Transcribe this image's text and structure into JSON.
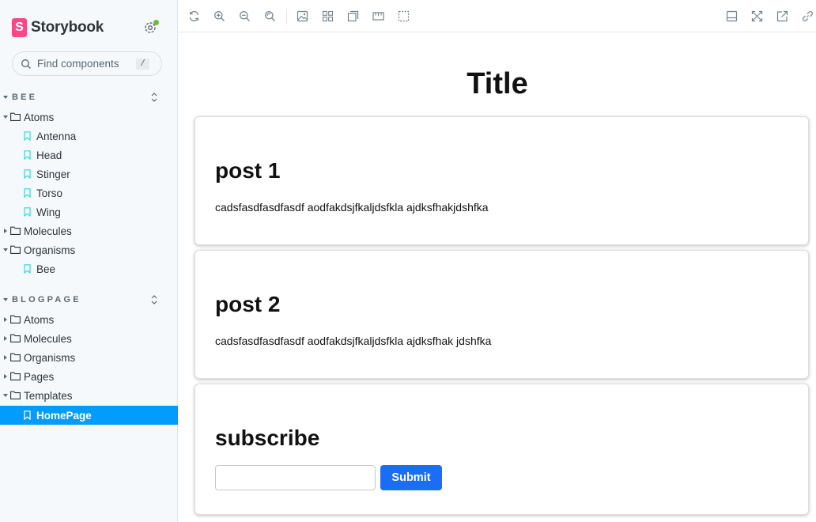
{
  "brand": {
    "name": "Storybook",
    "logo_letter": "S"
  },
  "search": {
    "placeholder": "Find components",
    "shortcut": "/"
  },
  "sidebar": {
    "sections": [
      {
        "label": "BEE"
      },
      {
        "label": "BLOGPAGE"
      }
    ],
    "items": [
      {
        "label": "Atoms"
      },
      {
        "label": "Antenna"
      },
      {
        "label": "Head"
      },
      {
        "label": "Stinger"
      },
      {
        "label": "Torso"
      },
      {
        "label": "Wing"
      },
      {
        "label": "Molecules"
      },
      {
        "label": "Organisms"
      },
      {
        "label": "Bee"
      },
      {
        "label": "Atoms"
      },
      {
        "label": "Molecules"
      },
      {
        "label": "Organisms"
      },
      {
        "label": "Pages"
      },
      {
        "label": "Templates"
      },
      {
        "label": "HomePage"
      }
    ],
    "active_item": "HomePage"
  },
  "toolbar": {
    "icons": [
      "reload-icon",
      "zoom-in-icon",
      "zoom-out-icon",
      "zoom-reset-icon",
      "background-icon",
      "grid-icon",
      "outline-icon",
      "measure-icon",
      "viewport-icon",
      "addons-panel-icon",
      "fullscreen-icon",
      "open-new-tab-icon",
      "copy-link-icon"
    ]
  },
  "canvas": {
    "title": "Title",
    "posts": [
      {
        "heading": "post 1",
        "body": "cadsfasdfasdfasdf aodfakdsjfkaljdsfkla ajdksfhakjdshfka"
      },
      {
        "heading": "post 2",
        "body": "cadsfasdfasdfasdf aodfakdsjfkaljdsfkla ajdksfhak jdshfka"
      }
    ],
    "subscribe": {
      "heading": "subscribe",
      "input_value": "",
      "button_label": "Submit"
    }
  },
  "colors": {
    "accent": "#029cfd",
    "brand": "#ff4785",
    "submit": "#1a6ef5",
    "status_dot": "#66bf3c",
    "story_icon": "#37d5d3"
  }
}
